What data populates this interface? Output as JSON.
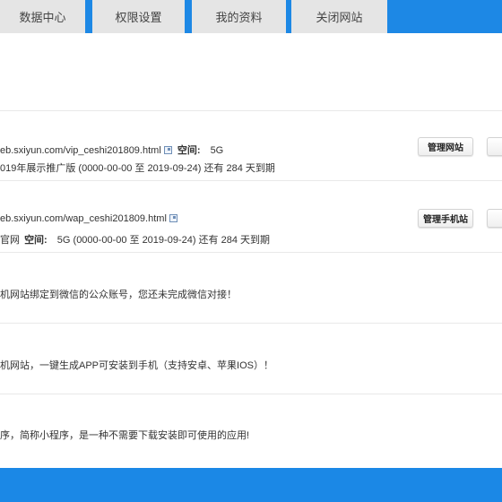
{
  "nav": {
    "tabs": [
      {
        "label": "数据中心"
      },
      {
        "label": "权限设置"
      },
      {
        "label": "我的资料"
      },
      {
        "label": "关闭网站"
      }
    ]
  },
  "rows": [
    {
      "url": "eb.sxiyun.com/vip_ceshi201809.html",
      "space_label": "空间:",
      "space_value": "5G",
      "line2": "019年展示推广版 (0000-00-00 至 2019-09-24) 还有 284 天到期",
      "button": "管理网站"
    },
    {
      "url": "eb.sxiyun.com/wap_ceshi201809.html",
      "line2_prefix": "官网",
      "space_label": "空间:",
      "line2_rest": "5G (0000-00-00 至 2019-09-24) 还有 284 天到期",
      "button": "管理手机站"
    },
    {
      "text": "机网站绑定到微信的公众账号，您还未完成微信对接！"
    },
    {
      "text": "机网站，一键生成APP可安装到手机（支持安卓、苹果IOS）！"
    },
    {
      "text": "序，简称小程序，是一种不需要下载安装即可使用的应用!"
    }
  ]
}
